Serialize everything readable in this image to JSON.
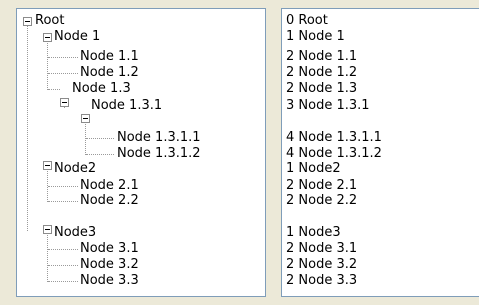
{
  "tree": {
    "root": "Root",
    "node1": "Node 1",
    "node1_1": "Node 1.1",
    "node1_2": "Node 1.2",
    "node1_3": "Node 1.3",
    "node1_3_1": "Node 1.3.1",
    "node1_3_1_1": "Node 1.3.1.1",
    "node1_3_1_2": "Node 1.3.1.2",
    "node2": "Node2",
    "node2_1": "Node 2.1",
    "node2_2": "Node 2.2",
    "node3": "Node3",
    "node3_1": "Node 3.1",
    "node3_2": "Node 3.2",
    "node3_3": "Node 3.3"
  },
  "list": [
    "0 Root",
    "1 Node 1",
    "2 Node 1.1",
    "2 Node 1.2",
    "2 Node 1.3",
    "3 Node 1.3.1",
    "4 Node 1.3.1.1",
    "4 Node 1.3.1.2",
    "1 Node2",
    "2 Node 2.1",
    "2 Node 2.2",
    "1 Node3",
    "2 Node 3.1",
    "2 Node 3.2",
    "2 Node 3.3"
  ],
  "colors": {
    "window_bg": "#ece9d8",
    "panel_border": "#7f9db9",
    "connector": "#9a9a9a"
  }
}
